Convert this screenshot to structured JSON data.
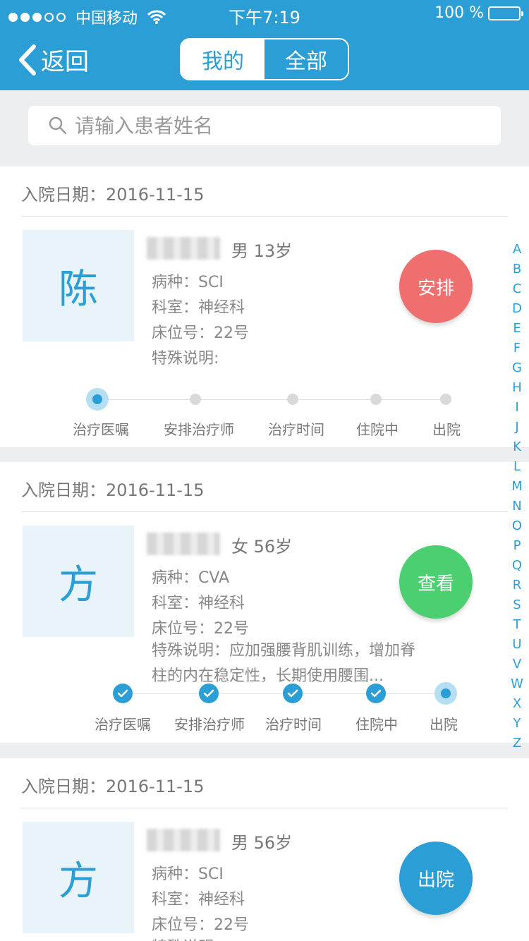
{
  "status_bar": {
    "carrier": "中国移动",
    "time": "下午7:19",
    "battery": "100 %"
  },
  "nav": {
    "back_label": "返回",
    "tabs": [
      {
        "label": "我的",
        "active": true
      },
      {
        "label": "全部",
        "active": false
      }
    ]
  },
  "search": {
    "placeholder": "请输入患者姓名"
  },
  "colors": {
    "brand": "#2b9fd5",
    "arrange": "#ef6f6e",
    "view": "#4ccf70",
    "discharge": "#2b9fd5"
  },
  "patients": [
    {
      "admission": "入院日期：2016-11-15",
      "avatar_char": "陈",
      "gender_age": "男   13岁",
      "disease": "病种：SCI",
      "department": "科室：神经科",
      "bed": "床位号：22号",
      "special": "特殊说明:",
      "action": "安排",
      "steps": [
        {
          "label": "治疗医嘱",
          "state": "current"
        },
        {
          "label": "安排治疗师",
          "state": "pending"
        },
        {
          "label": "治疗时间",
          "state": "pending"
        },
        {
          "label": "住院中",
          "state": "pending"
        },
        {
          "label": "出院",
          "state": "pending"
        }
      ]
    },
    {
      "admission": "入院日期：2016-11-15",
      "avatar_char": "方",
      "gender_age": "女   56岁",
      "disease": "病种：CVA",
      "department": "科室：神经科",
      "bed": "床位号：22号",
      "special": "特殊说明：应加强腰背肌训练，增加脊柱的内在稳定性，长期使用腰围...",
      "action": "查看",
      "steps": [
        {
          "label": "治疗医嘱",
          "state": "done"
        },
        {
          "label": "安排治疗师",
          "state": "done"
        },
        {
          "label": "治疗时间",
          "state": "done"
        },
        {
          "label": "住院中",
          "state": "done"
        },
        {
          "label": "出院",
          "state": "current"
        }
      ]
    },
    {
      "admission": "入院日期：2016-11-15",
      "avatar_char": "方",
      "gender_age": "男   56岁",
      "disease": "病种：SCI",
      "department": "科室：神经科",
      "bed": "床位号：22号",
      "special": "特殊说明",
      "action": "出院",
      "steps": []
    }
  ],
  "alphabet": [
    "A",
    "B",
    "C",
    "D",
    "E",
    "F",
    "G",
    "H",
    "I",
    "J",
    "K",
    "L",
    "M",
    "N",
    "O",
    "P",
    "Q",
    "R",
    "S",
    "T",
    "U",
    "V",
    "W",
    "X",
    "Y",
    "Z"
  ]
}
